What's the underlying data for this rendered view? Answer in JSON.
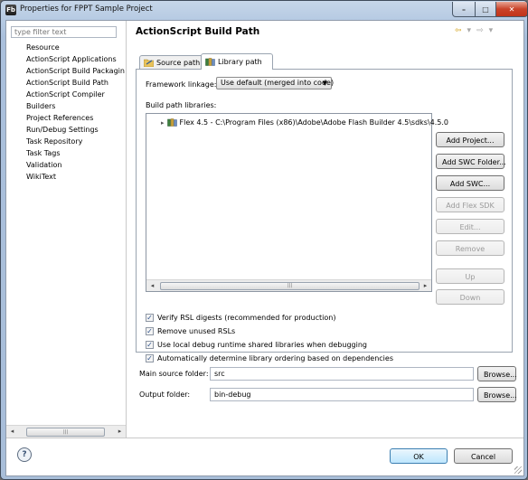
{
  "window": {
    "title": "Properties for FPPT Sample Project",
    "app_icon_text": "Fb",
    "controls": {
      "minimize": "–",
      "maximize": "□",
      "close": "✕"
    }
  },
  "sidebar": {
    "filter_placeholder": "type filter text",
    "items": [
      {
        "label": "Resource"
      },
      {
        "label": "ActionScript Applications"
      },
      {
        "label": "ActionScript Build Packagin"
      },
      {
        "label": "ActionScript Build Path",
        "selected": true
      },
      {
        "label": "ActionScript Compiler"
      },
      {
        "label": "Builders"
      },
      {
        "label": "Project References"
      },
      {
        "label": "Run/Debug Settings"
      },
      {
        "label": "Task Repository"
      },
      {
        "label": "Task Tags"
      },
      {
        "label": "Validation"
      },
      {
        "label": "WikiText"
      }
    ],
    "scroll": {
      "left": "◂",
      "right": "▸",
      "thumb": "|||"
    }
  },
  "page": {
    "title": "ActionScript Build Path",
    "nav": {
      "back": "⇦",
      "menu": "▾",
      "forward": "⇨",
      "menu2": "▾"
    }
  },
  "tabs": [
    {
      "label": "Source path",
      "active": false
    },
    {
      "label": "Library path",
      "active": true
    }
  ],
  "library": {
    "framework_label": "Framework linkage:",
    "framework_value": "Use default (merged into code)",
    "dropdown_arrow": "▼",
    "build_path_label": "Build path libraries:",
    "entries": [
      {
        "label": "Flex 4.5 - C:\\Program Files (x86)\\Adobe\\Adobe Flash Builder 4.5\\sdks\\4.5.0"
      }
    ],
    "expand_glyph": "▸",
    "scroll": {
      "left": "◂",
      "right": "▸",
      "thumb": "|||"
    },
    "buttons": {
      "add_project": "Add Project...",
      "add_swc_folder": "Add SWC Folder...",
      "add_swc": "Add SWC...",
      "add_flex_sdk": "Add Flex SDK",
      "edit": "Edit...",
      "remove": "Remove",
      "up": "Up",
      "down": "Down"
    },
    "options": [
      {
        "label": "Verify RSL digests (recommended for production)",
        "checked": true
      },
      {
        "label": "Remove unused RSLs",
        "checked": true
      },
      {
        "label": "Use local debug runtime shared libraries when debugging",
        "checked": true
      },
      {
        "label": "Automatically determine library ordering based on dependencies",
        "checked": true
      }
    ],
    "check_glyph": "✓"
  },
  "folders": {
    "main_source_label": "Main source folder:",
    "main_source_value": "src",
    "output_label": "Output folder:",
    "output_value": "bin-debug",
    "browse_label": "Browse..."
  },
  "footer": {
    "help_glyph": "?",
    "ok_label": "OK",
    "cancel_label": "Cancel"
  }
}
